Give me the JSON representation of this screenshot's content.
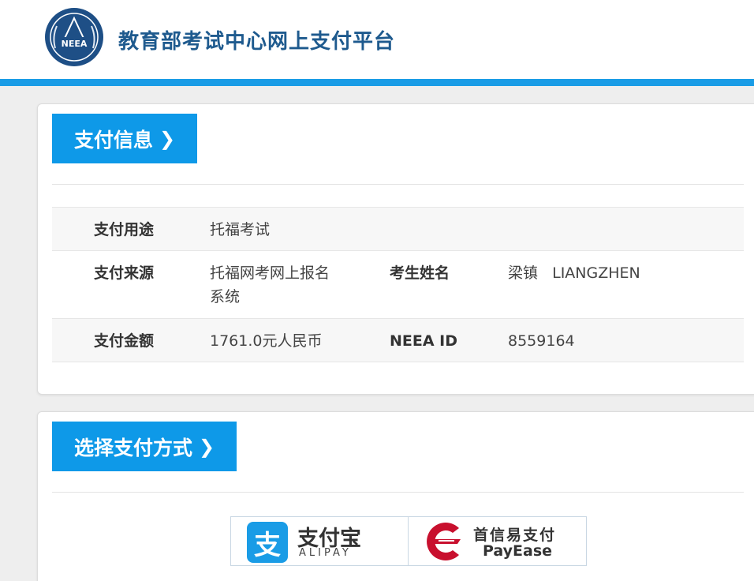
{
  "header": {
    "logo_text": "NEEA",
    "site_title": "教育部考试中心网上支付平台"
  },
  "payment_info": {
    "section_title": "支付信息",
    "rows": [
      {
        "label1": "支付用途",
        "value1": "托福考试",
        "label2": "",
        "value2": ""
      },
      {
        "label1": "支付来源",
        "value1": "托福网考网上报名系统",
        "label2": "考生姓名",
        "value2": "梁镇   LIANGZHEN"
      },
      {
        "label1": "支付金额",
        "value1": "1761.0元人民币",
        "label2": "NEEA ID",
        "value2": "8559164"
      }
    ]
  },
  "payment_method": {
    "section_title": "选择支付方式",
    "options": [
      {
        "name_cn": "支付宝",
        "name_en": "ALIPAY",
        "icon": "alipay-icon",
        "color": "#1a9ce6"
      },
      {
        "name_cn": "首信易支付",
        "name_en": "PayEase",
        "icon": "payease-icon",
        "color": "#c8102e"
      }
    ]
  },
  "colors": {
    "accent": "#0e99e8",
    "header_bar": "#1a9ce6",
    "title_text": "#1e5a8e"
  }
}
